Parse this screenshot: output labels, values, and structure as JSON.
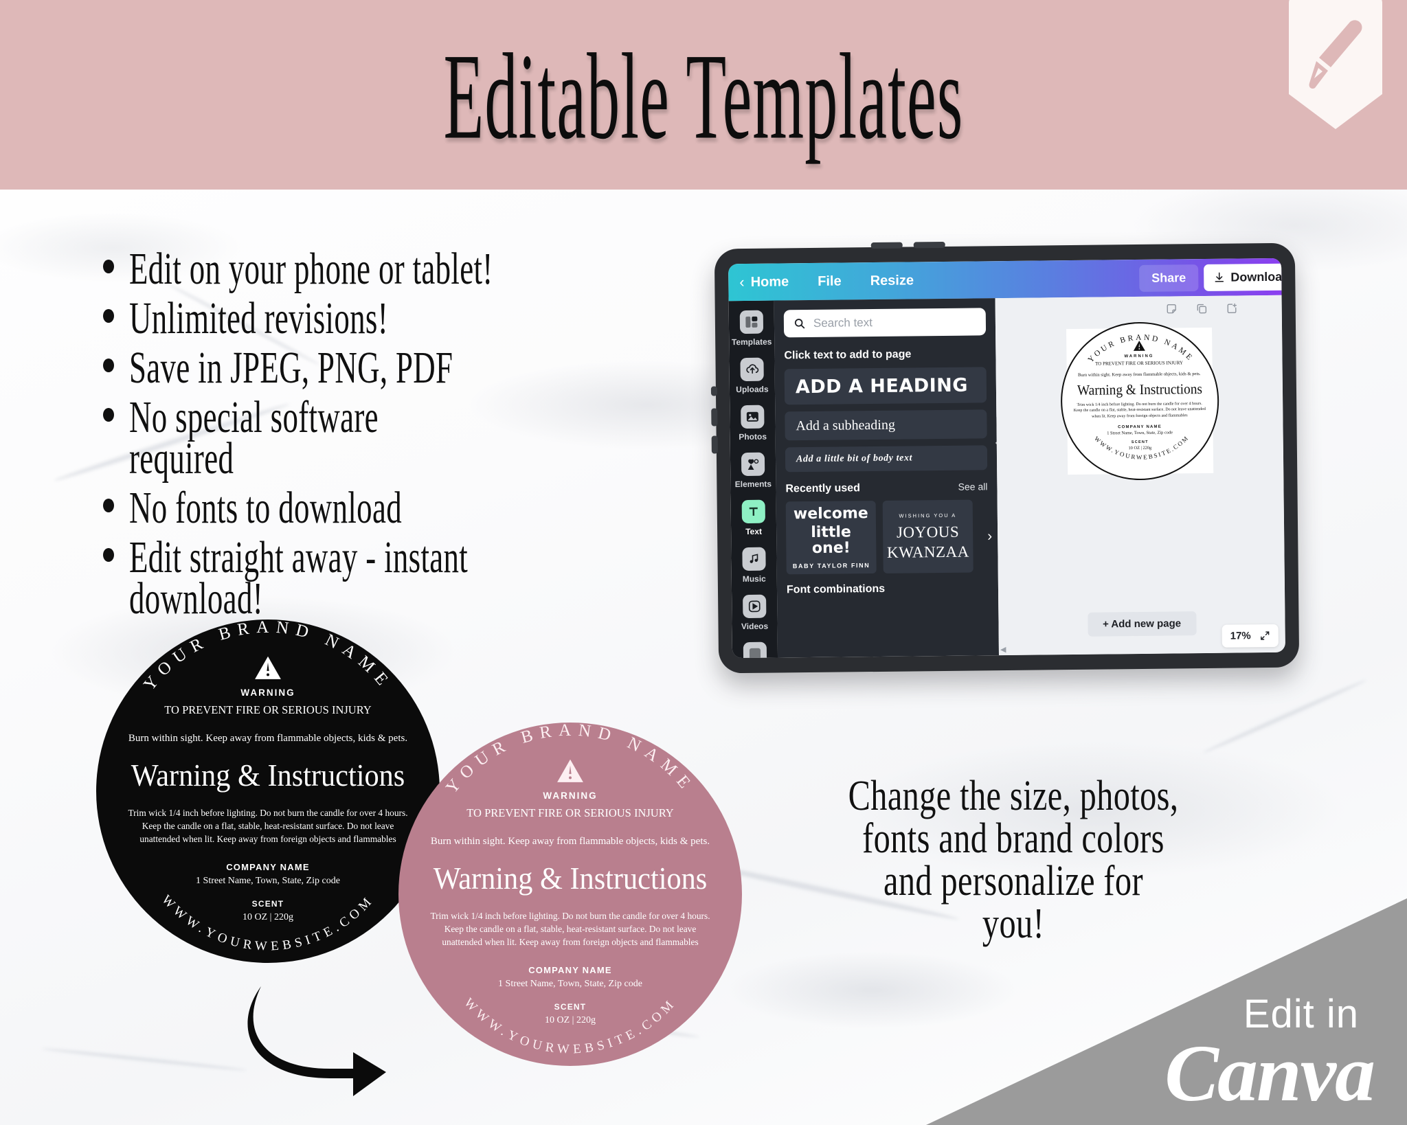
{
  "header": {
    "title": "Editable Templates",
    "badge_icon": "pencil-icon",
    "bg_color": "#deb8b8"
  },
  "features": {
    "bullets": [
      {
        "line1": "Edit on your phone or tablet!",
        "line2": ""
      },
      {
        "line1": "Unlimited revisions!",
        "line2": ""
      },
      {
        "line1": "Save in JPEG, PNG, PDF",
        "line2": ""
      },
      {
        "line1": "No special software",
        "line2": "required"
      },
      {
        "line1": "No fonts to download",
        "line2": ""
      },
      {
        "line1": "Edit straight away - instant",
        "line2": "download!"
      }
    ]
  },
  "promo": {
    "line1": "Change the size, photos,",
    "line2": "fonts and brand colors",
    "line3": "and personalize for",
    "line4": "you!"
  },
  "canva_corner": {
    "top_label": "Edit in",
    "brand": "Canva",
    "bg_color": "#9b9b9b"
  },
  "tablet": {
    "topbar": {
      "back_icon": "chevron-left-icon",
      "home": "Home",
      "file": "File",
      "resize": "Resize",
      "share": "Share",
      "download": "Download",
      "download_icon": "download-icon"
    },
    "rail": [
      {
        "label": "Templates",
        "icon": "templates-icon",
        "active": false
      },
      {
        "label": "Uploads",
        "icon": "upload-cloud-icon",
        "active": false
      },
      {
        "label": "Photos",
        "icon": "photo-icon",
        "active": false
      },
      {
        "label": "Elements",
        "icon": "elements-icon",
        "active": false
      },
      {
        "label": "Text",
        "icon": "text-icon",
        "active": true
      },
      {
        "label": "Music",
        "icon": "music-note-icon",
        "active": false
      },
      {
        "label": "Videos",
        "icon": "play-icon",
        "active": false
      }
    ],
    "panel": {
      "search_placeholder": "Search text",
      "search_icon": "search-icon",
      "section_title": "Click text to add to page",
      "text_cards": [
        "ADD A HEADING",
        "Add a subheading",
        "Add a little bit of body text"
      ],
      "recent_title": "Recently used",
      "see_all": "See all",
      "recent_items": [
        {
          "pre": "",
          "main_1": "welcome",
          "main_2": "little one!",
          "sub": "BABY TAYLOR FINN"
        },
        {
          "pre": "WISHING YOU A",
          "main_1": "JOYOUS",
          "main_2": "KWANZAA",
          "sub": ""
        }
      ],
      "next_icon": "chevron-right-icon",
      "collapse_icon": "chevron-left-icon",
      "font_combinations": "Font combinations"
    },
    "canvas": {
      "tools": [
        "notes-icon",
        "duplicate-icon",
        "add-page-icon"
      ],
      "add_new_page": "+ Add new page",
      "zoom_level": "17%",
      "expand_icon": "expand-icon"
    }
  },
  "label": {
    "brand": "YOUR BRAND NAME",
    "warning_icon": "warning-triangle-icon",
    "warning_word": "WARNING",
    "warning_sub": "TO PREVENT FIRE OR SERIOUS INJURY",
    "burn_line": "Burn within sight. Keep away from flammable objects, kids & pets.",
    "title": "Warning & Instructions",
    "instructions_1": "Trim wick 1/4 inch before lighting. Do not burn the candle for over 4",
    "instructions_2": "hours. Keep the candle on a flat, stable, heat-resistant surface.",
    "instructions_3": "Do not leave unattended when lit. Keep away from",
    "instructions_4": "foreign objects and flammables",
    "company_name": "COMPANY NAME",
    "address": "1 Street Name, Town, State, Zip code",
    "scent_label": "SCENT",
    "scent_value": "10 OZ | 220g",
    "website": "WWW.YOURWEBSITE.COM",
    "black_bg": "#0b0b0b",
    "mauve_bg": "#b97f8e"
  }
}
